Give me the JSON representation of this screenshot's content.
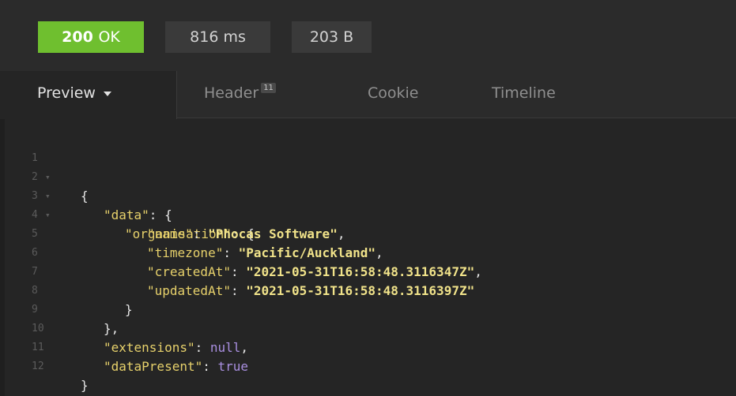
{
  "status": {
    "code": "200",
    "text": "OK",
    "time": "816 ms",
    "size": "203 B",
    "ok_color": "#6fbf2f"
  },
  "tabs": {
    "preview": "Preview",
    "header": "Header",
    "header_count": "11",
    "cookie": "Cookie",
    "timeline": "Timeline"
  },
  "code": {
    "lines": [
      {
        "n": "1",
        "fold": true
      },
      {
        "n": "2",
        "fold": true,
        "key": "\"data\""
      },
      {
        "n": "3",
        "fold": true,
        "key": "\"organisation\""
      },
      {
        "n": "4",
        "key": "\"name\"",
        "value": "\"Phocas Software\""
      },
      {
        "n": "5",
        "key": "\"timezone\"",
        "value": "\"Pacific/Auckland\""
      },
      {
        "n": "6",
        "key": "\"createdAt\"",
        "value": "\"2021-05-31T16:58:48.3116347Z\""
      },
      {
        "n": "7",
        "key": "\"updatedAt\"",
        "value": "\"2021-05-31T16:58:48.3116397Z\""
      },
      {
        "n": "8"
      },
      {
        "n": "9"
      },
      {
        "n": "10",
        "key": "\"extensions\"",
        "value": "null"
      },
      {
        "n": "11",
        "key": "\"dataPresent\"",
        "value": "true"
      },
      {
        "n": "12"
      }
    ]
  },
  "icons": {
    "preview_dropdown": "caret-down-icon",
    "fold_marker": "fold-caret-icon"
  }
}
